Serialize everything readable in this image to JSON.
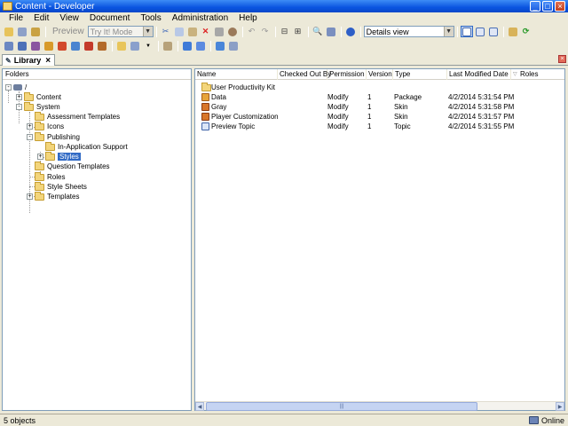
{
  "window": {
    "title": "Content - Developer",
    "minimize": "_",
    "maximize": "□",
    "close": "×"
  },
  "menu": [
    "File",
    "Edit",
    "View",
    "Document",
    "Tools",
    "Administration",
    "Help"
  ],
  "toolbar": {
    "preview_label": "Preview",
    "mode_select": "Try It! Mode",
    "view_select": "Details view"
  },
  "tab": {
    "label": "Library",
    "close": "×"
  },
  "folders": {
    "header": "Folders",
    "nodes": [
      {
        "label": "/",
        "expander": "-"
      },
      {
        "label": "Content",
        "expander": "+"
      },
      {
        "label": "System",
        "expander": "-"
      },
      {
        "label": "Assessment Templates",
        "expander": ""
      },
      {
        "label": "Icons",
        "expander": "+"
      },
      {
        "label": "Publishing",
        "expander": "-"
      },
      {
        "label": "In-Application Support",
        "expander": ""
      },
      {
        "label": "Styles",
        "expander": "+"
      },
      {
        "label": "Question Templates",
        "expander": ""
      },
      {
        "label": "Roles",
        "expander": ""
      },
      {
        "label": "Style Sheets",
        "expander": ""
      },
      {
        "label": "Templates",
        "expander": "+"
      }
    ]
  },
  "details": {
    "columns": [
      "Name",
      "Checked Out By",
      "Permission",
      "Version",
      "Type",
      "Last Modified Date",
      "Roles"
    ],
    "rows": [
      {
        "name": "User Productivity Kit",
        "checked_out_by": "",
        "permission": "",
        "version": "",
        "type": "",
        "modified": "",
        "icon": "folder-icon"
      },
      {
        "name": "Data",
        "checked_out_by": "",
        "permission": "Modify",
        "version": "1",
        "type": "Package",
        "modified": "4/2/2014 5:31:54 PM",
        "icon": "package-icon"
      },
      {
        "name": "Gray",
        "checked_out_by": "",
        "permission": "Modify",
        "version": "1",
        "type": "Skin",
        "modified": "4/2/2014 5:31:58 PM",
        "icon": "skin-icon"
      },
      {
        "name": "Player Customization",
        "checked_out_by": "",
        "permission": "Modify",
        "version": "1",
        "type": "Skin",
        "modified": "4/2/2014 5:31:57 PM",
        "icon": "skin-icon"
      },
      {
        "name": "Preview Topic",
        "checked_out_by": "",
        "permission": "Modify",
        "version": "1",
        "type": "Topic",
        "modified": "4/2/2014 5:31:55 PM",
        "icon": "topic-icon"
      }
    ]
  },
  "status": {
    "objects": "5 objects",
    "online": "Online"
  },
  "colors": {
    "selection": "#316ac5",
    "titlebar": "#0a54e0",
    "chrome": "#ece9d8"
  }
}
